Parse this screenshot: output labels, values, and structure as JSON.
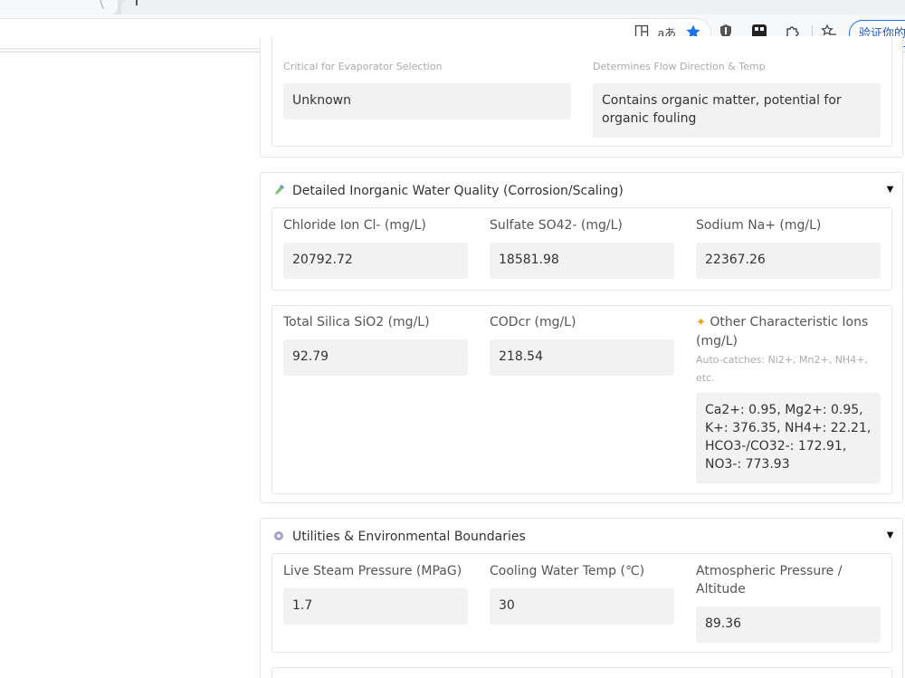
{
  "browser": {
    "verify_label": "验证你的身",
    "icons": [
      "split-screen-icon",
      "read-aloud-icon",
      "favorite-star-icon",
      "shield-extension-icon",
      "app-extension-icon",
      "extensions-puzzle-icon",
      "favorites-list-icon"
    ],
    "accent_color": "#1a73e8"
  },
  "top_section": {
    "field1": {
      "hint": "Critical for Evaporator Selection",
      "value": "Unknown"
    },
    "field2": {
      "hint": "Determines Flow Direction & Temp",
      "value": "Contains organic matter, potential for organic fouling"
    }
  },
  "inorganic": {
    "title": "Detailed Inorganic Water Quality (Corrosion/Scaling)",
    "toggle": "▼",
    "chloride": {
      "label": "Chloride Ion Cl- (mg/L)",
      "value": "20792.72"
    },
    "sulfate": {
      "label": "Sulfate SO42- (mg/L)",
      "value": "18581.98"
    },
    "sodium": {
      "label": "Sodium Na+ (mg/L)",
      "value": "22367.26"
    },
    "silica": {
      "label": "Total Silica SiO2 (mg/L)",
      "value": "92.79"
    },
    "codcr": {
      "label": "CODcr (mg/L)",
      "value": "218.54"
    },
    "other": {
      "label": "Other Characteristic Ions (mg/L)",
      "hint": "Auto-catches: Ni2+, Mn2+, NH4+, etc.",
      "value": "Ca2+: 0.95, Mg2+: 0.95, K+: 376.35, NH4+: 22.21, HCO3-/CO32-: 172.91, NO3-: 773.93"
    }
  },
  "utilities": {
    "title": "Utilities & Environmental Boundaries",
    "toggle": "▼",
    "steam": {
      "label": "Live Steam Pressure (MPaG)",
      "value": "1.7"
    },
    "cooling": {
      "label": "Cooling Water Temp (℃)",
      "value": "30"
    },
    "atm": {
      "label": "Atmospheric Pressure / Altitude",
      "value": "89.36"
    }
  }
}
